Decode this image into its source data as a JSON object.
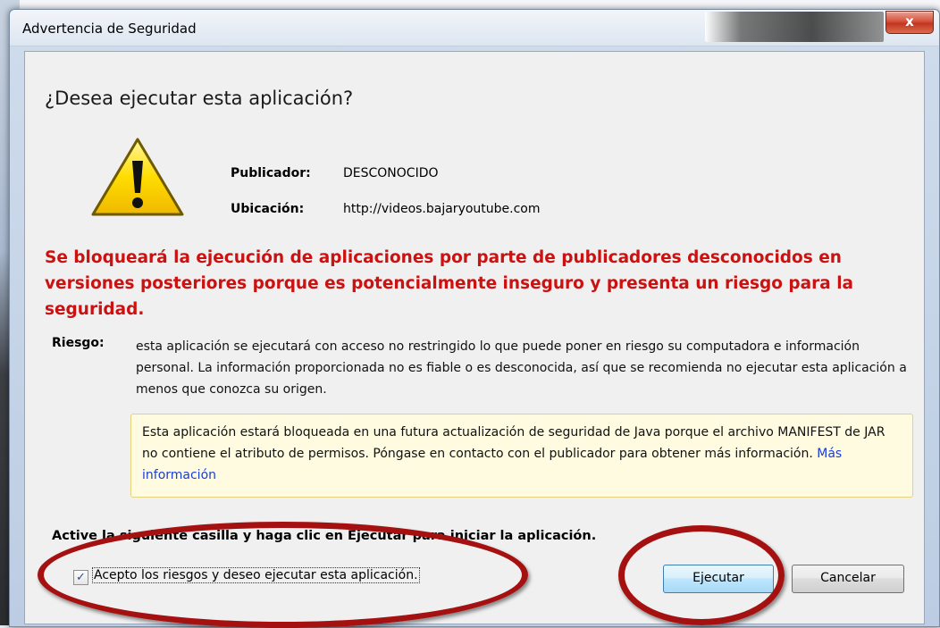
{
  "window": {
    "title": "Advertencia de Seguridad",
    "close_glyph": "x"
  },
  "dialog": {
    "heading": "¿Desea ejecutar esta aplicación?",
    "publisher_label": "Publicador:",
    "publisher_value": "DESCONOCIDO",
    "location_label": "Ubicación:",
    "location_value": "http://videos.bajaryoutube.com",
    "red_warning": "Se bloqueará la ejecución de aplicaciones por parte de publicadores desconocidos en versiones posteriores porque es potencialmente inseguro y presenta un riesgo para la seguridad.",
    "risk_label": "Riesgo:",
    "risk_text": "esta aplicación se ejecutará con acceso no restringido lo que puede poner en riesgo su computadora e información personal. La información proporcionada no es fiable o es desconocida, así que se recomienda no ejecutar esta aplicación a menos que conozca su origen.",
    "notice_text": "Esta aplicación estará bloqueada en una futura actualización de seguridad de Java porque el archivo MANIFEST de JAR no contiene el atributo de permisos. Póngase en contacto con el publicador para obtener más información. ",
    "notice_link": "Más información",
    "instruction": "Active la siguiente casilla y haga clic en Ejecutar para iniciar la aplicación.",
    "checkbox_label": "Acepto los riesgos y deseo ejecutar esta aplicación.",
    "checkbox_checked": true,
    "run_button": "Ejecutar",
    "cancel_button": "Cancelar"
  },
  "icons": {
    "warning": "warning-triangle-icon",
    "close": "close-icon",
    "check": "checkmark-icon"
  },
  "colors": {
    "warning_red": "#cc1111",
    "annotation_red": "#a51010",
    "link_blue": "#1a3dd6",
    "notice_bg": "#fffbe0",
    "warning_yellow": "#ffd600"
  }
}
